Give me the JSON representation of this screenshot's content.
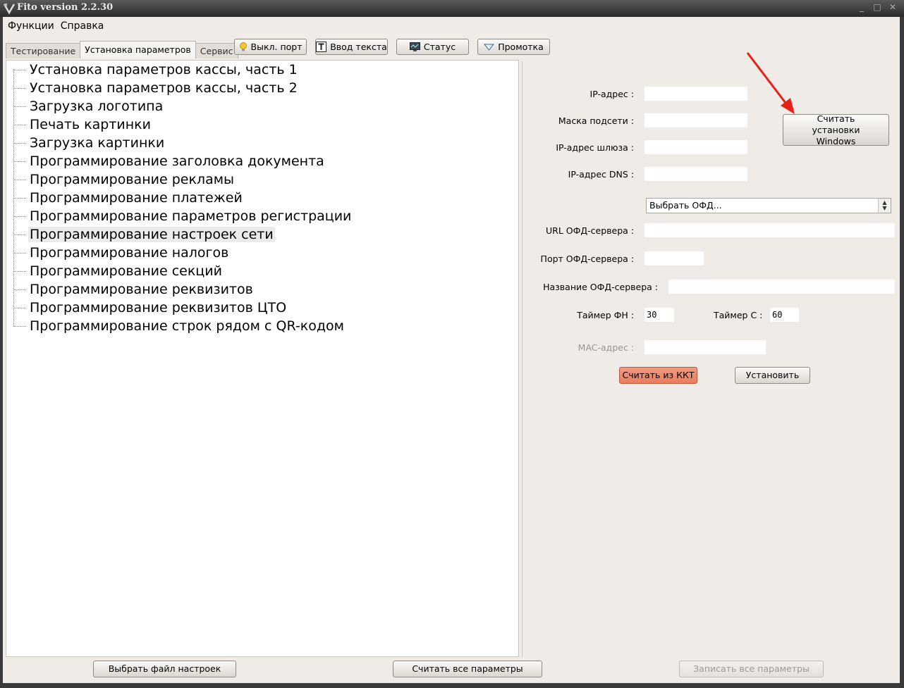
{
  "window": {
    "title": "Fito version 2.2.30",
    "controls": [
      "_",
      "□",
      "✕"
    ]
  },
  "menu": {
    "items": [
      "Функции",
      "Справка"
    ]
  },
  "tabs": [
    {
      "label": "Тестирование",
      "active": false
    },
    {
      "label": "Установка параметров",
      "active": true
    },
    {
      "label": "Сервис",
      "active": false
    }
  ],
  "toolbar": {
    "port_off": {
      "label": "Выкл. порт",
      "icon": "bulb-icon"
    },
    "text_input": {
      "label": "Ввод текста",
      "icon": "text-T-icon"
    },
    "status": {
      "label": "Статус",
      "icon": "monitor-icon"
    },
    "feed": {
      "label": "Промотка",
      "icon": "triangle-down-icon"
    }
  },
  "tree": {
    "items": [
      "Установка параметров кассы, часть 1",
      "Установка параметров кассы, часть 2",
      "Загрузка логотипа",
      "Печать картинки",
      "Загрузка картинки",
      "Программирование заголовка документа",
      "Программирование рекламы",
      "Программирование платежей",
      "Программирование параметров регистрации",
      "Программирование настроек сети",
      "Программирование налогов",
      "Программирование секций",
      "Программирование реквизитов",
      "Программирование реквизитов ЦТО",
      "Программирование строк рядом с QR-кодом"
    ],
    "selected_index": 9
  },
  "network": {
    "ip_label": "IP-адрес :",
    "ip_value": "",
    "mask_label": "Маска подсети :",
    "mask_value": "",
    "gateway_label": "IP-адрес шлюза :",
    "gateway_value": "",
    "dns_label": "IP-адрес DNS :",
    "dns_value": "",
    "read_windows_btn": "Считать установки Windows",
    "ofd_select": "Выбрать ОФД...",
    "ofd_url_label": "URL ОФД-сервера :",
    "ofd_url_value": "",
    "ofd_port_label": "Порт ОФД-сервера :",
    "ofd_port_value": "",
    "ofd_name_label": "Название ОФД-сервера :",
    "ofd_name_value": "",
    "timer_fn_label": "Таймер ФН :",
    "timer_fn_value": "30",
    "timer_c_label": "Таймер С :",
    "timer_c_value": "60",
    "mac_label": "MAC-адрес :",
    "mac_value": "",
    "read_kkt_btn": "Считать из ККТ",
    "set_btn": "Установить"
  },
  "bottom": {
    "choose_file": "Выбрать файл настроек",
    "read_all": "Считать все параметры",
    "write_all": "Записать все параметры"
  },
  "colors": {
    "accent_button": "#ef8b6e",
    "annotation_arrow": "#e8201a"
  }
}
